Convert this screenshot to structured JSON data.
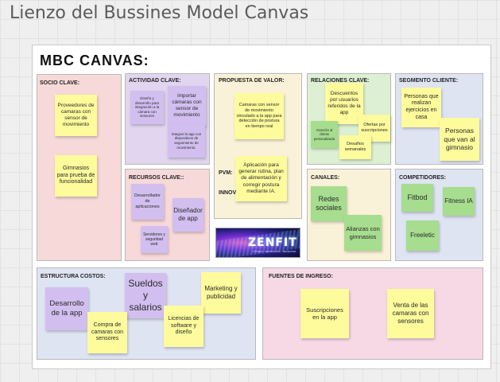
{
  "board": {
    "title": "Lienzo del Bussines Model Canvas"
  },
  "canvas": {
    "heading": "MBC  CANVAS:",
    "sections": {
      "socios": "SOCIO CLAVE:",
      "actividad": "ACTIVIDAD CLAVE:",
      "recursos": "RECURSOS CLAVE::",
      "propuesta": "PROPUESTA DE VALOR:",
      "relaciones": "RELACIONES CLAVE:",
      "canales": "CANALES:",
      "segmento": "SEGMENTO CLIENTE:",
      "competidores": "COMPETIDORES:",
      "costos": "ESTRUCTURA COSTOS:",
      "ingresos": "FUENTES DE INGRESO:"
    },
    "pvm_label": "PVM:",
    "innov_label": "INNOV",
    "logo_text": "ZENFIT",
    "logo_tagline": "FITNESS · TECNOLOGÍA · BIENESTAR"
  },
  "colors": {
    "yellow": "#fdfb9b",
    "purple": "#d2bff0",
    "green": "#a6dd8e"
  },
  "notes": {
    "socio1": "Proveedores de camaras con sensor de movimiento",
    "socio2": "Gimnasios para prueba de funcionalidad",
    "act1": "Diseño y desarrollo para integración a la cámara con sensores",
    "act2": "importar cámaras con sensor de movimiento",
    "act3": "Integrar la app con dispositivos de seguimiento de movimiento.",
    "rec1": "Desarrollador de aplicaciones",
    "rec2": "Diseñador de app",
    "rec3": "Servidores y seguridad web",
    "prop1": "Camaras con sensor de movimiento vinculado a la app para detección de postura en tiempo real",
    "prop2": "Aplicación para generar rutina, plan de alimentación y corregir postura mediante IA.",
    "rel1": "Descuentos por usuarios referidos de la app",
    "rel2": "Atención al cliente personalizada",
    "rel3": "Ofertas por suscripciones",
    "rel4": "Desafíos semanales",
    "can1": "Redes sociales",
    "can2": "Alianzas con gimnasios",
    "seg1": "Personas que realizan ejercicios en casa",
    "seg2": "Personas que van al gimnasio",
    "comp1": "Fitbod",
    "comp2": "Fitness IA",
    "comp3": "Freeletic",
    "cost1": "Desarrollo de la app",
    "cost2": "Sueldos y salarios",
    "cost3": "Marketing y publicidad",
    "cost4": "Compra de camaras con sensores",
    "cost5": "Licencias de software y diseño",
    "ing1": "Suscripciones en la app",
    "ing2": "Venta de las camaras con sensores"
  }
}
